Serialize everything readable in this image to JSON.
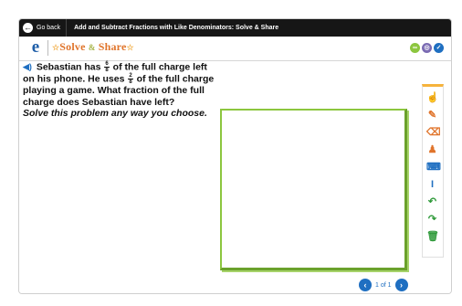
{
  "topbar": {
    "back_label": "Go back",
    "lesson_title": "Add and Subtract Fractions with Like Denominators: Solve & Share"
  },
  "header": {
    "logo": "e",
    "app_name_solve": "Solve",
    "app_name_amp": "&",
    "app_name_share": "Share",
    "icons": [
      "glossary-icon",
      "tools-icon",
      "help-icon"
    ],
    "colors": {
      "green": "#8cc63f",
      "purple": "#7b6bb3",
      "blue": "#1f6fc1"
    }
  },
  "problem": {
    "p1": "Sebastian has",
    "f1_num": "6",
    "f1_den": "8",
    "p2": "of the full charge left on his phone. He uses",
    "f2_num": "2",
    "f2_den": "8",
    "p3": "of the full charge playing a game. What fraction of the full charge does Sebastian have left?",
    "instruction": "Solve this problem any way you choose."
  },
  "toolbar": {
    "tools": [
      "pointer-tool-icon",
      "pen-tool-icon",
      "eraser-tool-icon",
      "stamp-tool-icon",
      "keyboard-tool-icon",
      "text-tool-icon",
      "undo-icon",
      "redo-icon",
      "trash-icon"
    ],
    "accent": "#f6b33c"
  },
  "pager": {
    "page_text": "1 of 1"
  }
}
